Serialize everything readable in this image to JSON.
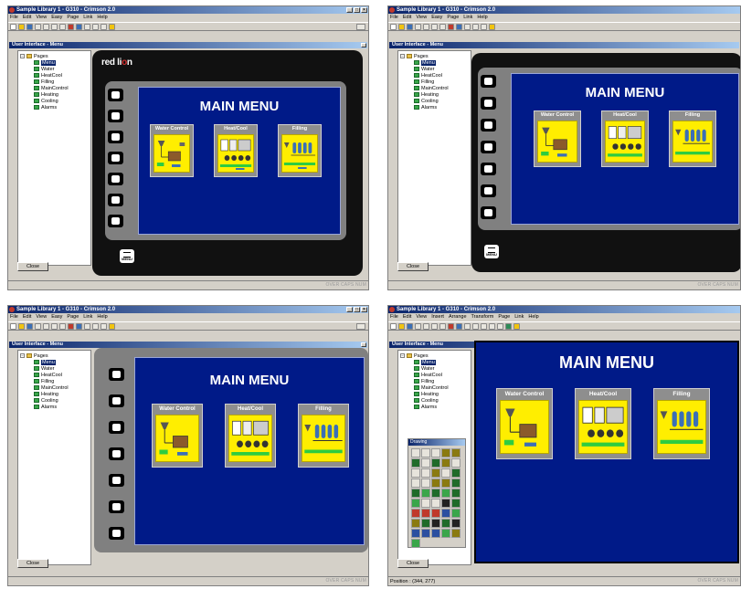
{
  "windows": [
    {
      "title": "Sample Library 1 - G310 - Crimson 2.0",
      "menu": [
        "File",
        "Edit",
        "View",
        "Easy",
        "Page",
        "Link",
        "Help"
      ],
      "panel_title": "User Interface - Menu",
      "tree_root": "Pages",
      "pages": [
        "Menu",
        "Water",
        "HeatCool",
        "Filling",
        "MainControl",
        "Heating",
        "Cooling",
        "Alarms"
      ],
      "selected_page": "Menu",
      "close_label": "Close",
      "status_right": "OVER  CAPS  NUM",
      "device": {
        "brand": "red lion",
        "screen_title": "MAIN MENU",
        "buttons": [
          "Water Control",
          "Heat/Cool",
          "Filling"
        ],
        "menu_key_label": "MENU"
      }
    },
    {
      "title": "Sample Library 1 - G310 - Crimson 2.0",
      "menu": [
        "File",
        "Edit",
        "View",
        "Easy",
        "Page",
        "Link",
        "Help"
      ],
      "panel_title": "User Interface - Menu",
      "tree_root": "Pages",
      "pages": [
        "Menu",
        "Water",
        "HeatCool",
        "Filling",
        "MainControl",
        "Heating",
        "Cooling",
        "Alarms"
      ],
      "selected_page": "Menu",
      "close_label": "Close",
      "status_right": "OVER  CAPS  NUM",
      "device": {
        "screen_title": "MAIN MENU",
        "buttons": [
          "Water Control",
          "Heat/Cool",
          "Filling"
        ],
        "menu_key_label": "MENU"
      }
    },
    {
      "title": "Sample Library 1 - G310 - Crimson 2.0",
      "menu": [
        "File",
        "Edit",
        "View",
        "Easy",
        "Page",
        "Link",
        "Help"
      ],
      "panel_title": "User Interface - Menu",
      "tree_root": "Pages",
      "pages": [
        "Menu",
        "Water",
        "HeatCool",
        "Filling",
        "MainControl",
        "Heating",
        "Cooling",
        "Alarms"
      ],
      "selected_page": "Menu",
      "close_label": "Close",
      "status_right": "OVER  CAPS  NUM",
      "device": {
        "screen_title": "MAIN MENU",
        "buttons": [
          "Water Control",
          "Heat/Cool",
          "Filling"
        ]
      }
    },
    {
      "title": "Sample Library 1 - G310 - Crimson 2.0",
      "menu": [
        "File",
        "Edit",
        "View",
        "Insert",
        "Arrange",
        "Transform",
        "Page",
        "Link",
        "Help"
      ],
      "panel_title": "User Interface - Menu",
      "tree_root": "Pages",
      "pages": [
        "Menu",
        "Water",
        "HeatCool",
        "Filling",
        "MainControl",
        "Heating",
        "Cooling",
        "Alarms"
      ],
      "selected_page": "Menu",
      "close_label": "Close",
      "palette_title": "Drawing",
      "status_left": "Position : (344, 277)",
      "status_right": "OVER  CAPS  NUM",
      "device": {
        "screen_title": "MAIN MENU",
        "buttons": [
          "Water Control",
          "Heat/Cool",
          "Filling"
        ]
      }
    }
  ]
}
